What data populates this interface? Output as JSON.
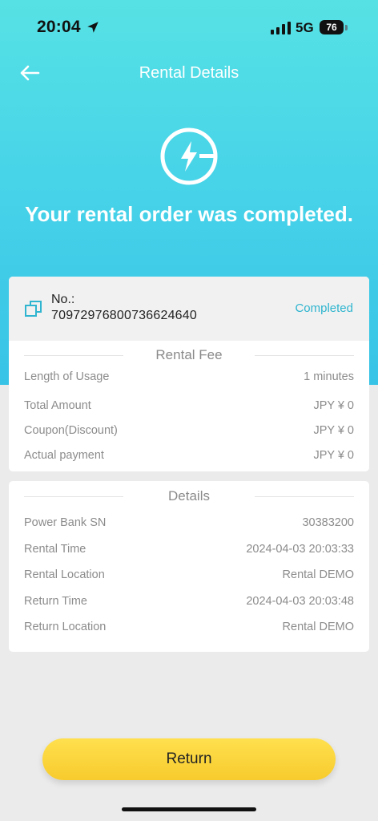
{
  "status_bar": {
    "time": "20:04",
    "network": "5G",
    "battery": "76",
    "icons": [
      "location-arrow-icon",
      "signal-bars-icon"
    ]
  },
  "header": {
    "title": "Rental Details",
    "back_icon": "back-arrow-icon"
  },
  "hero": {
    "icon": "lightning-bolt-icon",
    "message": "Your rental order was completed."
  },
  "order": {
    "no_label": "No.:",
    "no_value": "7097297680073662464​0",
    "status": "Completed",
    "icon": "copy-icon"
  },
  "rental_fee": {
    "title": "Rental Fee",
    "rows": [
      {
        "label": "Length of Usage",
        "value": "1  minutes"
      },
      {
        "label": "Total Amount",
        "value": "JPY ¥ 0"
      },
      {
        "label": "Coupon(Discount)",
        "value": "JPY ¥ 0"
      },
      {
        "label": "Actual payment",
        "value": "JPY ¥ 0"
      }
    ]
  },
  "details": {
    "title": "Details",
    "rows": [
      {
        "label": "Power Bank SN",
        "value": "30383200"
      },
      {
        "label": "Rental Time",
        "value": "2024-04-03 20:03:33"
      },
      {
        "label": "Rental Location",
        "value": "Rental DEMO"
      },
      {
        "label": "Return Time",
        "value": "2024-04-03 20:03:48"
      },
      {
        "label": "Return Location",
        "value": "Rental DEMO"
      }
    ]
  },
  "footer": {
    "button": "Return"
  },
  "colors": {
    "accent": "#2fb5cf",
    "hero_top": "#56e2e4",
    "hero_bottom": "#37c3e6",
    "button": "#f7cb2d"
  }
}
